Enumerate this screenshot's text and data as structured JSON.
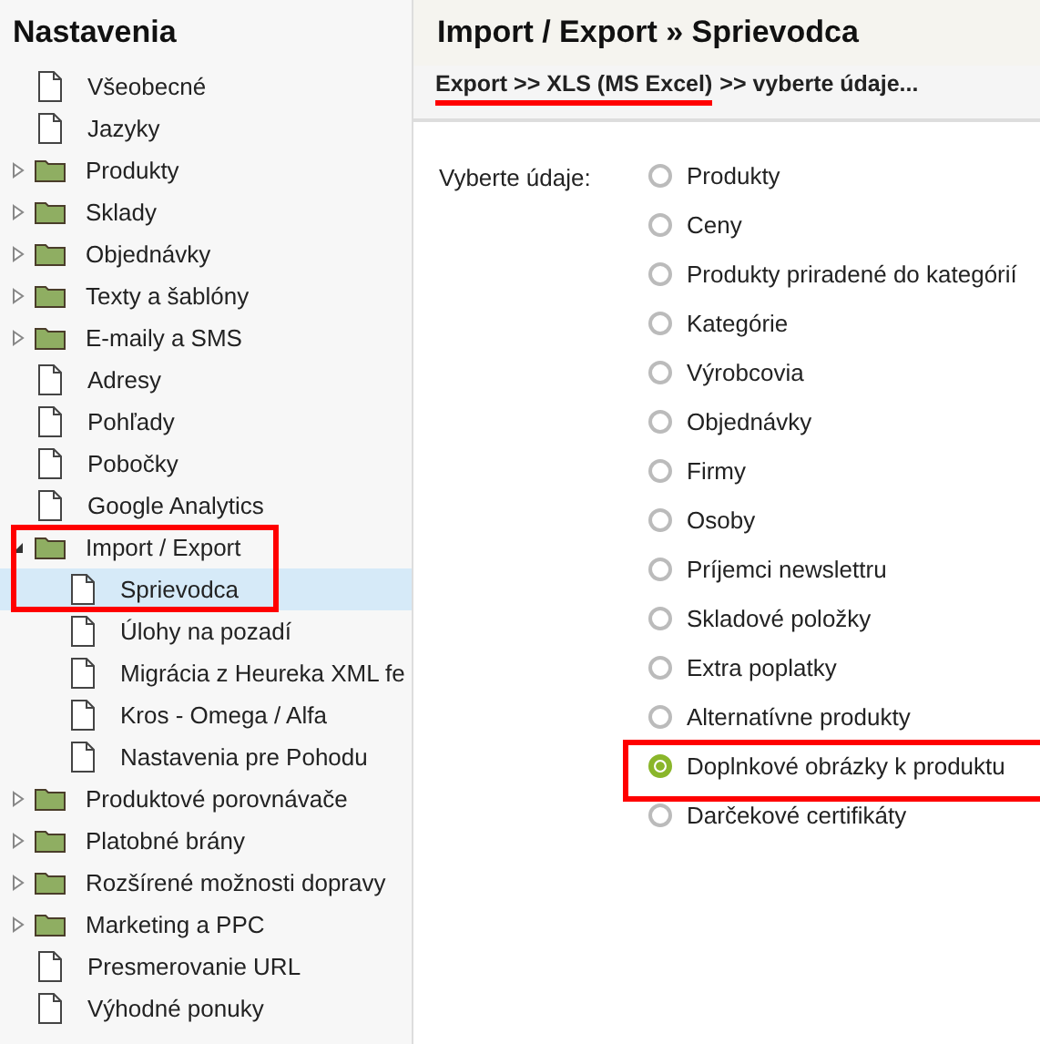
{
  "sidebar": {
    "title": "Nastavenia",
    "items": [
      {
        "kind": "file",
        "label": "Všeobecné",
        "selected": false
      },
      {
        "kind": "file",
        "label": "Jazyky",
        "selected": false
      },
      {
        "kind": "folder",
        "label": "Produkty",
        "expanded": false,
        "selected": false
      },
      {
        "kind": "folder",
        "label": "Sklady",
        "expanded": false,
        "selected": false
      },
      {
        "kind": "folder",
        "label": "Objednávky",
        "expanded": false,
        "selected": false
      },
      {
        "kind": "folder",
        "label": "Texty a šablóny",
        "expanded": false,
        "selected": false
      },
      {
        "kind": "folder",
        "label": "E-maily a SMS",
        "expanded": false,
        "selected": false
      },
      {
        "kind": "file",
        "label": "Adresy",
        "selected": false
      },
      {
        "kind": "file",
        "label": "Pohľady",
        "selected": false
      },
      {
        "kind": "file",
        "label": "Pobočky",
        "selected": false
      },
      {
        "kind": "file",
        "label": "Google Analytics",
        "selected": false
      },
      {
        "kind": "folder",
        "label": "Import / Export",
        "expanded": true,
        "selected": false,
        "annotated": true,
        "children": [
          {
            "kind": "file",
            "label": "Sprievodca",
            "selected": true
          },
          {
            "kind": "file",
            "label": "Úlohy na pozadí",
            "selected": false
          },
          {
            "kind": "file",
            "label": "Migrácia z Heureka XML fe",
            "selected": false
          },
          {
            "kind": "file",
            "label": "Kros - Omega / Alfa",
            "selected": false
          },
          {
            "kind": "file",
            "label": "Nastavenia pre Pohodu",
            "selected": false
          }
        ]
      },
      {
        "kind": "folder",
        "label": "Produktové porovnávače",
        "expanded": false,
        "selected": false
      },
      {
        "kind": "folder",
        "label": "Platobné brány",
        "expanded": false,
        "selected": false
      },
      {
        "kind": "folder",
        "label": "Rozšírené možnosti dopravy",
        "expanded": false,
        "selected": false
      },
      {
        "kind": "folder",
        "label": "Marketing a PPC",
        "expanded": false,
        "selected": false
      },
      {
        "kind": "file",
        "label": "Presmerovanie URL",
        "selected": false
      },
      {
        "kind": "file",
        "label": "Výhodné ponuky",
        "selected": false
      }
    ]
  },
  "main": {
    "title": "Import / Export » Sprievodca",
    "breadcrumb": [
      {
        "text": "Export >> XLS (MS Excel)",
        "underlined": true
      },
      {
        "text": ">> vyberte údaje...",
        "underlined": false
      }
    ],
    "field_label": "Vyberte údaje:",
    "options": [
      {
        "label": "Produkty",
        "selected": false
      },
      {
        "label": "Ceny",
        "selected": false
      },
      {
        "label": "Produkty priradené do kategórií",
        "selected": false
      },
      {
        "label": "Kategórie",
        "selected": false
      },
      {
        "label": "Výrobcovia",
        "selected": false
      },
      {
        "label": "Objednávky",
        "selected": false
      },
      {
        "label": "Firmy",
        "selected": false
      },
      {
        "label": "Osoby",
        "selected": false
      },
      {
        "label": "Príjemci newslettru",
        "selected": false
      },
      {
        "label": "Skladové položky",
        "selected": false
      },
      {
        "label": "Extra poplatky",
        "selected": false
      },
      {
        "label": "Alternatívne produkty",
        "selected": false
      },
      {
        "label": "Doplnkové obrázky k produktu",
        "selected": true,
        "annotated": true
      },
      {
        "label": "Darčekové certifikáty",
        "selected": false
      }
    ]
  }
}
